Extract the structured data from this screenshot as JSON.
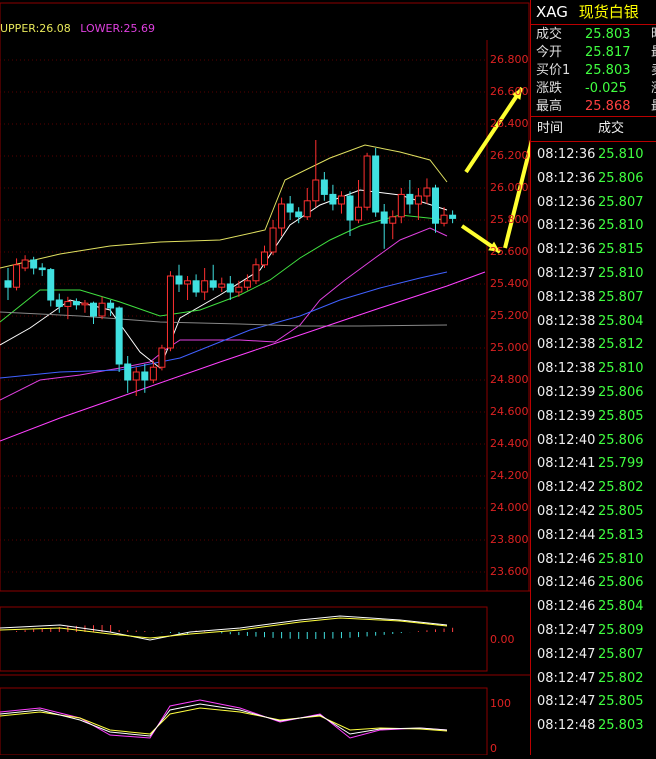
{
  "legend": {
    "upper_label": "UPPER:26.08",
    "lower_label": "LOWER:25.69"
  },
  "price_axis": [
    "26.800",
    "26.600",
    "26.400",
    "26.200",
    "26.000",
    "25.800",
    "25.600",
    "25.400",
    "25.200",
    "25.000",
    "24.800",
    "24.600",
    "24.400",
    "24.200",
    "24.000",
    "23.800",
    "23.600"
  ],
  "macd_axis": [
    "0.00"
  ],
  "kdj_axis": [
    "100",
    "0"
  ],
  "colors": {
    "up": "#ff3030",
    "down": "#40e0e0",
    "accent": "#ffff33",
    "grid": "#8b0000"
  },
  "instrument": {
    "code": "XAG",
    "name": "现货白银"
  },
  "quote": [
    {
      "label": "成交",
      "value": "25.803",
      "color": "#40ff40",
      "trunc": "昨"
    },
    {
      "label": "今开",
      "value": "25.817",
      "color": "#40ff40",
      "trunc": "最"
    },
    {
      "label": "买价1",
      "value": "25.803",
      "color": "#40ff40",
      "trunc": "卖"
    },
    {
      "label": "涨跌",
      "value": "-0.025",
      "color": "#40ff40",
      "trunc": "涨"
    },
    {
      "label": "最高",
      "value": "25.868",
      "color": "#ff4040",
      "trunc": "最"
    }
  ],
  "ticks_header": {
    "time": "时间",
    "price": "成交"
  },
  "ticks": [
    {
      "time": "08:12:36",
      "price": "25.810"
    },
    {
      "time": "08:12:36",
      "price": "25.806"
    },
    {
      "time": "08:12:36",
      "price": "25.807"
    },
    {
      "time": "08:12:36",
      "price": "25.810"
    },
    {
      "time": "08:12:36",
      "price": "25.815"
    },
    {
      "time": "08:12:37",
      "price": "25.810"
    },
    {
      "time": "08:12:38",
      "price": "25.807"
    },
    {
      "time": "08:12:38",
      "price": "25.804"
    },
    {
      "time": "08:12:38",
      "price": "25.812"
    },
    {
      "time": "08:12:38",
      "price": "25.810"
    },
    {
      "time": "08:12:39",
      "price": "25.806"
    },
    {
      "time": "08:12:39",
      "price": "25.805"
    },
    {
      "time": "08:12:40",
      "price": "25.806"
    },
    {
      "time": "08:12:41",
      "price": "25.799"
    },
    {
      "time": "08:12:42",
      "price": "25.802"
    },
    {
      "time": "08:12:42",
      "price": "25.805"
    },
    {
      "time": "08:12:44",
      "price": "25.813"
    },
    {
      "time": "08:12:46",
      "price": "25.810"
    },
    {
      "time": "08:12:46",
      "price": "25.806"
    },
    {
      "time": "08:12:46",
      "price": "25.804"
    },
    {
      "time": "08:12:47",
      "price": "25.809"
    },
    {
      "time": "08:12:47",
      "price": "25.807"
    },
    {
      "time": "08:12:47",
      "price": "25.802"
    },
    {
      "time": "08:12:47",
      "price": "25.805"
    },
    {
      "time": "08:12:48",
      "price": "25.803"
    }
  ],
  "candles": [
    [
      25.42,
      25.38,
      25.5,
      25.3
    ],
    [
      25.38,
      25.52,
      25.56,
      25.36
    ],
    [
      25.5,
      25.55,
      25.58,
      25.48
    ],
    [
      25.55,
      25.5,
      25.57,
      25.46
    ],
    [
      25.5,
      25.49,
      25.53,
      25.45
    ],
    [
      25.49,
      25.3,
      25.5,
      25.26
    ],
    [
      25.3,
      25.26,
      25.34,
      25.22
    ],
    [
      25.26,
      25.29,
      25.32,
      25.18
    ],
    [
      25.29,
      25.27,
      25.31,
      25.24
    ],
    [
      25.27,
      25.28,
      25.3,
      25.22
    ],
    [
      25.28,
      25.2,
      25.29,
      25.15
    ],
    [
      25.2,
      25.28,
      25.32,
      25.18
    ],
    [
      25.28,
      25.25,
      25.3,
      25.2
    ],
    [
      25.25,
      24.9,
      25.26,
      24.85
    ],
    [
      24.9,
      24.8,
      24.95,
      24.72
    ],
    [
      24.8,
      24.85,
      24.88,
      24.7
    ],
    [
      24.85,
      24.8,
      24.9,
      24.72
    ],
    [
      24.8,
      24.88,
      24.92,
      24.78
    ],
    [
      24.88,
      25.0,
      25.02,
      24.86
    ],
    [
      25.0,
      25.45,
      25.48,
      24.98
    ],
    [
      25.45,
      25.4,
      25.52,
      25.35
    ],
    [
      25.4,
      25.42,
      25.45,
      25.3
    ],
    [
      25.42,
      25.35,
      25.46,
      25.32
    ],
    [
      25.35,
      25.42,
      25.5,
      25.3
    ],
    [
      25.42,
      25.38,
      25.52,
      25.36
    ],
    [
      25.38,
      25.4,
      25.44,
      25.35
    ],
    [
      25.4,
      25.35,
      25.45,
      25.3
    ],
    [
      25.35,
      25.38,
      25.42,
      25.32
    ],
    [
      25.38,
      25.42,
      25.46,
      25.36
    ],
    [
      25.42,
      25.52,
      25.56,
      25.4
    ],
    [
      25.52,
      25.6,
      25.64,
      25.5
    ],
    [
      25.6,
      25.75,
      25.8,
      25.58
    ],
    [
      25.75,
      25.9,
      25.94,
      25.7
    ],
    [
      25.9,
      25.85,
      25.95,
      25.8
    ],
    [
      25.85,
      25.82,
      25.88,
      25.78
    ],
    [
      25.82,
      25.92,
      26.0,
      25.8
    ],
    [
      25.92,
      26.05,
      26.3,
      25.88
    ],
    [
      26.05,
      25.96,
      26.1,
      25.92
    ],
    [
      25.96,
      25.9,
      26.02,
      25.86
    ],
    [
      25.9,
      25.95,
      25.98,
      25.84
    ],
    [
      25.95,
      25.8,
      25.98,
      25.7
    ],
    [
      25.8,
      25.88,
      26.05,
      25.78
    ],
    [
      25.88,
      26.2,
      26.22,
      25.86
    ],
    [
      26.2,
      25.85,
      26.25,
      25.82
    ],
    [
      25.85,
      25.78,
      25.9,
      25.62
    ],
    [
      25.78,
      25.82,
      25.86,
      25.68
    ],
    [
      25.82,
      25.96,
      26.0,
      25.78
    ],
    [
      25.96,
      25.9,
      26.05,
      25.84
    ],
    [
      25.9,
      25.95,
      26.0,
      25.8
    ],
    [
      25.95,
      26.0,
      26.06,
      25.9
    ],
    [
      26.0,
      25.78,
      26.02,
      25.72
    ],
    [
      25.78,
      25.83,
      25.88,
      25.76
    ],
    [
      25.83,
      25.81,
      25.86,
      25.78
    ]
  ]
}
